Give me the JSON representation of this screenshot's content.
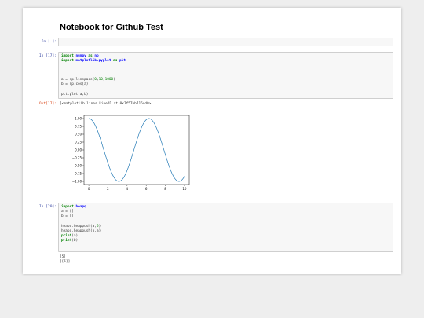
{
  "notebook": {
    "title": "Notebook for Github Test"
  },
  "cells": {
    "empty": {
      "prompt": "In [ ]:"
    },
    "c17": {
      "prompt": "In [17]:",
      "line1": {
        "kw1": "import",
        "mod": "numpy",
        "kw2": "as",
        "alias": "np"
      },
      "line2": {
        "kw1": "import",
        "mod": "matplotlib.pyplot",
        "kw2": "as",
        "alias": "plt"
      },
      "line3": {
        "pre": "a = np.linspace(",
        "n1": "0",
        "sep1": ",",
        "n2": "10",
        "sep2": ",",
        "n3": "1000",
        "post": ")"
      },
      "line4": "b = np.cos(a)",
      "line5": "plt.plot(a,b)",
      "out_prompt": "Out[17]:",
      "out_text": "[<matplotlib.lines.Line2D at 0x7f57bb7164d0>]"
    },
    "c20": {
      "prompt": "In [20]:",
      "line1": {
        "kw": "import",
        "mod": "heapq"
      },
      "line2": "a = []",
      "line3": "b = []",
      "line4": {
        "pre": "heapq.heappush(a,",
        "n": "5",
        "post": ")"
      },
      "line5": "heapq.heappush(b,a)",
      "line6": {
        "kw": "print",
        "post": "(a)"
      },
      "line7": {
        "kw": "print",
        "post": "(b)"
      },
      "out1": "[5]",
      "out2": "[[5]]"
    }
  },
  "chart_data": {
    "type": "line",
    "function": "y = cos(x)",
    "x_range": [
      0,
      10
    ],
    "n_points": 1000,
    "xlim": [
      -0.5,
      10.5
    ],
    "ylim": [
      -1.1,
      1.1
    ],
    "xticks": [
      "0",
      "2",
      "4",
      "6",
      "8",
      "10"
    ],
    "yticks": [
      "1.00",
      "0.75",
      "0.50",
      "0.25",
      "0.00",
      "−0.25",
      "−0.50",
      "−0.75",
      "−1.00"
    ],
    "line_color": "#1f77b4",
    "grid": false,
    "title": "",
    "xlabel": "",
    "ylabel": ""
  }
}
